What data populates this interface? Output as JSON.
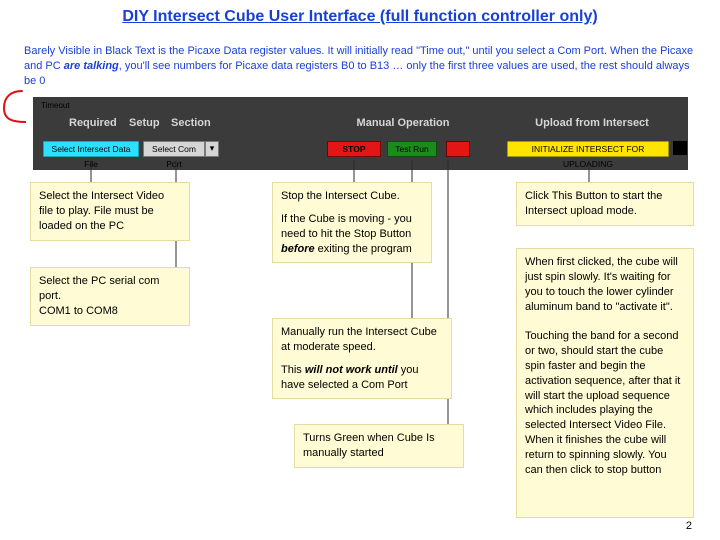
{
  "title": "DIY Intersect Cube  User Interface (full function controller only)",
  "intro_pre": "Barely Visible in Black Text is the Picaxe Data register values.  It will initially read \"Time out,\"  until you select a Com Port. When the Picaxe and PC ",
  "intro_em": "are talking",
  "intro_post": ", you'll see numbers for Picaxe data registers B0 to B13 … only the first three values are used, the rest should always be 0",
  "toolbar": {
    "timeout": "Timeout",
    "nav": {
      "required": "Required",
      "setup": "Setup",
      "section": "Section",
      "manual": "Manual Operation",
      "upload": "Upload from Intersect"
    },
    "buttons": {
      "select_file": "Select Intersect Data File",
      "select_com": "Select Com Port",
      "stop": "STOP",
      "test_run": "Test Run",
      "initialize": "INITIALIZE INTERSECT FOR UPLOADING"
    },
    "combo_symbol": "▾"
  },
  "notes": {
    "a": "Select the Intersect Video file to play.  File must be loaded on the PC",
    "b": "Select the PC serial com port.\nCOM1 to COM8",
    "c_p1": "Stop the Intersect Cube.",
    "c_p2_pre": "If the Cube is moving - you need to hit the Stop Button ",
    "c_p2_em": "before",
    "c_p2_post": " exiting the program",
    "d_p1": "Manually run the Intersect Cube at moderate speed.",
    "d_p2_pre": "This ",
    "d_p2_em": "will not work until",
    "d_p2_post": " you have selected a Com Port",
    "e": "Turns Green when Cube Is manually started",
    "f": "Click This Button to start the Intersect upload mode.",
    "g": "When first clicked, the cube will just spin slowly.  It's waiting for you to touch the lower cylinder aluminum band to \"activate it\".\n\nTouching the band for a second or two, should start the cube spin faster and begin the activation sequence, after that it will start the upload sequence which includes playing the selected Intersect Video File.  When it finishes the cube will return to spinning  slowly.  You can then click to stop button"
  },
  "page_number": "2"
}
